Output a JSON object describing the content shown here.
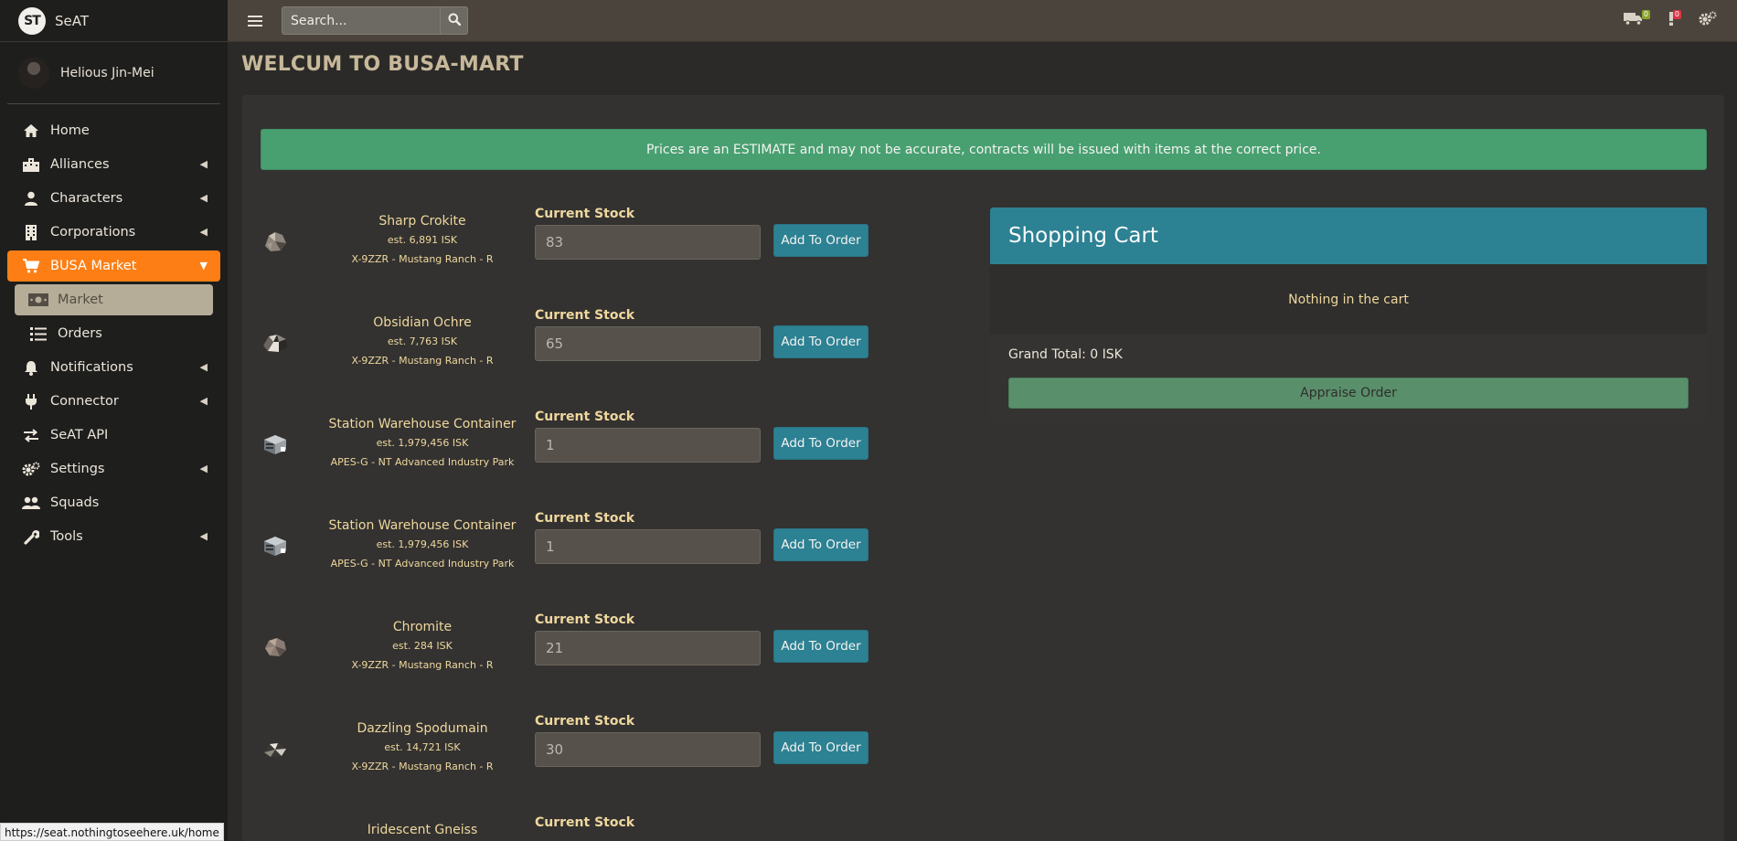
{
  "app": {
    "logo_text": "ST",
    "name": "SeAT"
  },
  "user": {
    "name": "Helious Jin-Mei"
  },
  "sidebar": {
    "items": [
      {
        "label": "Home",
        "icon": "home-icon",
        "chevron": false
      },
      {
        "label": "Alliances",
        "icon": "building-icon",
        "chevron": true
      },
      {
        "label": "Characters",
        "icon": "user-icon",
        "chevron": true
      },
      {
        "label": "Corporations",
        "icon": "office-building-icon",
        "chevron": true
      },
      {
        "label": "BUSA Market",
        "icon": "shopping-cart-icon",
        "chevron": true,
        "active": true
      },
      {
        "label": "Market",
        "icon": "money-bill-icon",
        "sub": true,
        "selected": true
      },
      {
        "label": "Orders",
        "icon": "list-icon",
        "sub": true
      },
      {
        "label": "Notifications",
        "icon": "bell-icon",
        "chevron": true
      },
      {
        "label": "Connector",
        "icon": "plug-icon",
        "chevron": true
      },
      {
        "label": "SeAT API",
        "icon": "exchange-icon",
        "chevron": false
      },
      {
        "label": "Settings",
        "icon": "cogs-icon",
        "chevron": true
      },
      {
        "label": "Squads",
        "icon": "users-icon",
        "chevron": false
      },
      {
        "label": "Tools",
        "icon": "wrench-icon",
        "chevron": true
      }
    ]
  },
  "topbar": {
    "search_placeholder": "Search...",
    "icons": [
      {
        "name": "truck-icon",
        "badge": "0",
        "badge_color": "#8aa52a"
      },
      {
        "name": "exclamation-icon",
        "badge": "0",
        "badge_color": "#dc3545"
      },
      {
        "name": "cogs-icon"
      }
    ]
  },
  "page": {
    "title": "WELCUM TO BUSA-MART",
    "alert": "Prices are an ESTIMATE and may not be accurate, contracts will be issued with items at the correct price."
  },
  "products": [
    {
      "name": "Sharp Crokite",
      "price": "est. 6,891 ISK",
      "location": "X-9ZZR - Mustang Ranch - R",
      "stock_label": "Current Stock",
      "stock": "83",
      "button": "Add To Order",
      "icon": "ore-icon"
    },
    {
      "name": "Obsidian Ochre",
      "price": "est. 7,763 ISK",
      "location": "X-9ZZR - Mustang Ranch - R",
      "stock_label": "Current Stock",
      "stock": "65",
      "button": "Add To Order",
      "icon": "ore-icon"
    },
    {
      "name": "Station Warehouse Container",
      "price": "est. 1,979,456 ISK",
      "location": "APES-G - NT Advanced Industry Park",
      "stock_label": "Current Stock",
      "stock": "1",
      "button": "Add To Order",
      "icon": "container-icon"
    },
    {
      "name": "Station Warehouse Container",
      "price": "est. 1,979,456 ISK",
      "location": "APES-G - NT Advanced Industry Park",
      "stock_label": "Current Stock",
      "stock": "1",
      "button": "Add To Order",
      "icon": "container-icon"
    },
    {
      "name": "Chromite",
      "price": "est. 284 ISK",
      "location": "X-9ZZR - Mustang Ranch - R",
      "stock_label": "Current Stock",
      "stock": "21",
      "button": "Add To Order",
      "icon": "ore-icon"
    },
    {
      "name": "Dazzling Spodumain",
      "price": "est. 14,721 ISK",
      "location": "X-9ZZR - Mustang Ranch - R",
      "stock_label": "Current Stock",
      "stock": "30",
      "button": "Add To Order",
      "icon": "ore-icon"
    },
    {
      "name": "Iridescent Gneiss",
      "stock_label": "Current Stock"
    }
  ],
  "cart": {
    "title": "Shopping Cart",
    "empty_text": "Nothing in the cart",
    "grand_total": "Grand Total: 0 ISK",
    "appraise_label": "Appraise Order"
  },
  "status_url": "https://seat.nothingtoseehere.uk/home"
}
